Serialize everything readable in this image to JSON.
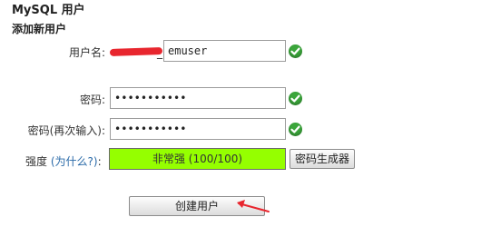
{
  "section_title": "MySQL 用户",
  "subsection_title": "添加新用户",
  "username": {
    "label": "用户名:",
    "prefix": "_",
    "value": "emuser",
    "status_icon": "check-icon"
  },
  "password": {
    "label": "密码:",
    "value": "•••••••••••",
    "status_icon": "check-icon"
  },
  "password_confirm": {
    "label": "密码(再次输入):",
    "value": "•••••••••••",
    "status_icon": "check-icon"
  },
  "strength": {
    "label": "强度",
    "why_link": "(为什么?)",
    "colon": ":",
    "value_text": "非常强 (100/100)",
    "score": 100,
    "bar_color": "#95ff00"
  },
  "buttons": {
    "generator": "密码生成器",
    "create": "创建用户"
  },
  "colors": {
    "ok_green": "#3ba63b",
    "annotation_arrow": "#e8262e"
  }
}
